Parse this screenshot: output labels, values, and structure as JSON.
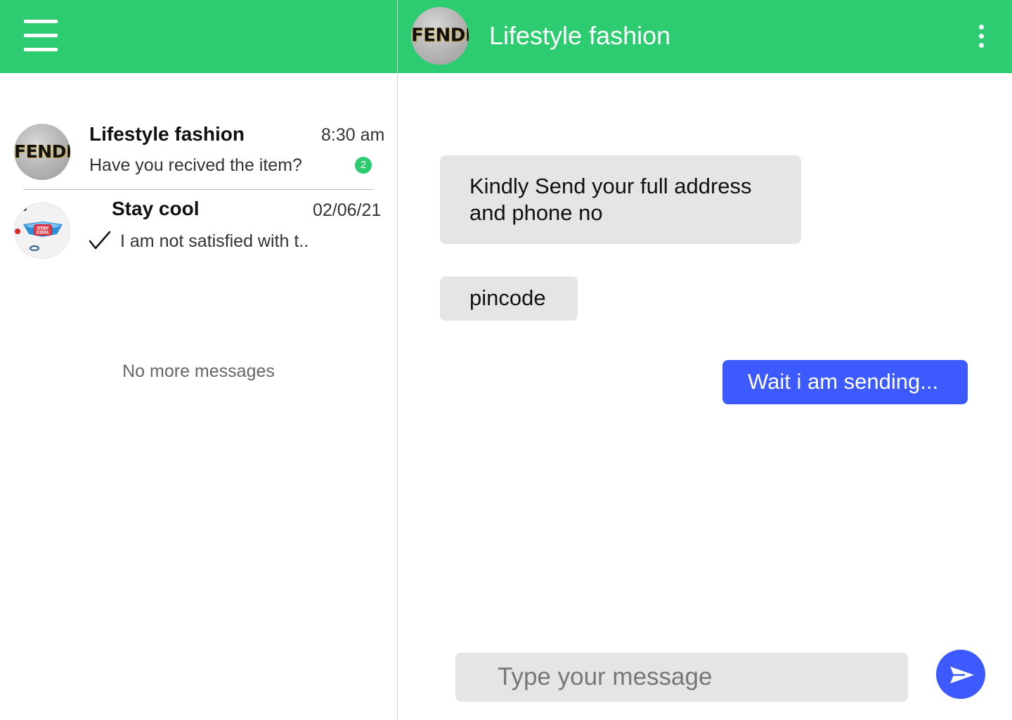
{
  "sidebar": {
    "conversations": [
      {
        "name": "Lifestyle fashion",
        "time": "8:30 am",
        "preview": "Have you recived the item?",
        "unread": "2",
        "avatar_text": "FENDI"
      },
      {
        "name": "Stay cool",
        "time": "02/06/21",
        "preview": "I am not satisfied with t..",
        "avatar_text": "STAY COOL",
        "status_icon": "checkmark-icon"
      }
    ],
    "empty_text": "No more messages"
  },
  "chat": {
    "title": "Lifestyle fashion",
    "avatar_text": "FENDI",
    "messages": [
      {
        "direction": "incoming",
        "text": "Kindly Send your full address and phone no"
      },
      {
        "direction": "incoming",
        "text": "pincode"
      },
      {
        "direction": "outgoing",
        "text": "Wait i am sending..."
      }
    ],
    "composer": {
      "placeholder": "Type your message",
      "value": ""
    }
  },
  "icons": {
    "menu": "hamburger-menu-icon",
    "more": "kebab-menu-icon",
    "send": "send-icon",
    "delivered": "checkmark-icon"
  },
  "colors": {
    "header": "#2ecc71",
    "unread_badge": "#2ecc71",
    "incoming_bubble": "#e5e5e5",
    "outgoing_bubble": "#3d5afe",
    "send_button": "#3d5afe",
    "composer": "#e5e5e5"
  }
}
